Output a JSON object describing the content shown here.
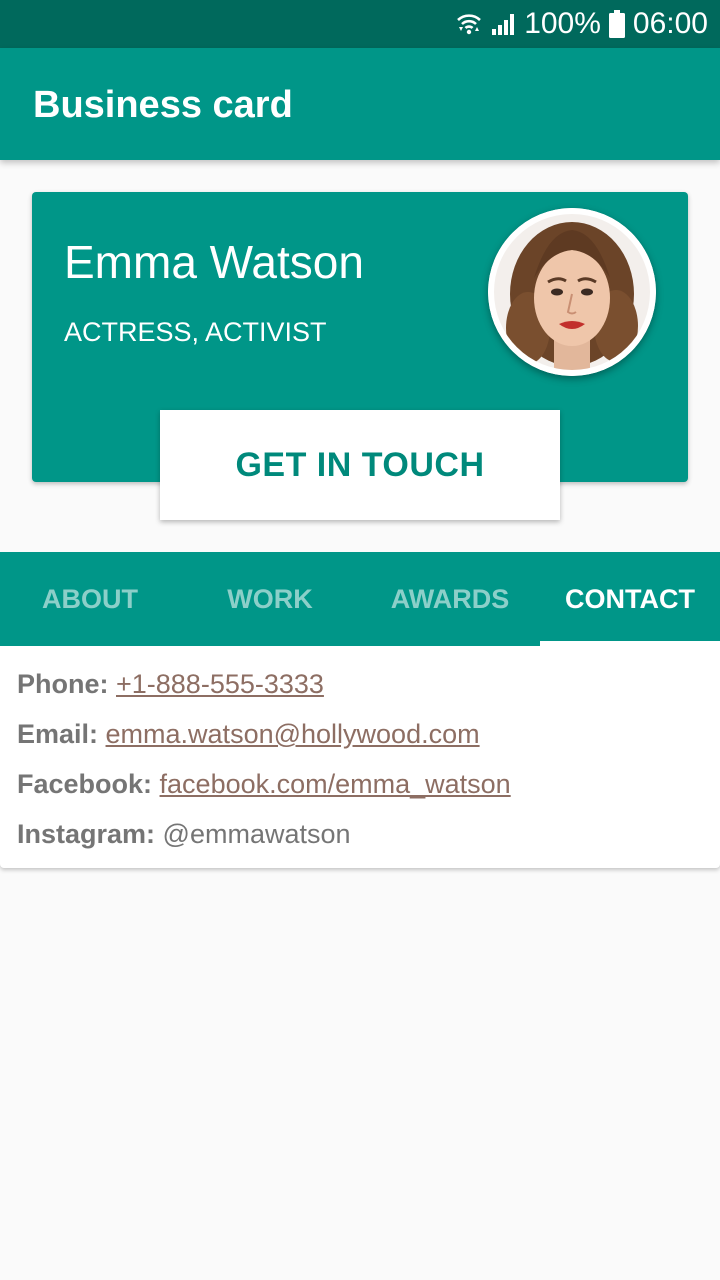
{
  "status_bar": {
    "battery": "100%",
    "time": "06:00"
  },
  "app_bar": {
    "title": "Business card"
  },
  "profile": {
    "name": "Emma Watson",
    "role": "ACTRESS, ACTIVIST",
    "button_label": "GET IN TOUCH"
  },
  "tabs": [
    {
      "label": "ABOUT",
      "active": false
    },
    {
      "label": "WORK",
      "active": false
    },
    {
      "label": "AWARDS",
      "active": false
    },
    {
      "label": "CONTACT",
      "active": true
    }
  ],
  "contact": {
    "phone_label": "Phone:",
    "phone": "+1-888-555-3333",
    "email_label": "Email:",
    "email": "emma.watson@hollywood.com",
    "facebook_label": "Facebook:",
    "facebook": "facebook.com/emma_watson",
    "instagram_label": "Instagram:",
    "instagram": "@emmawatson"
  },
  "colors": {
    "status_bar": "#00695c",
    "primary": "#009688",
    "button_text": "#00897b",
    "link": "#8d6e63",
    "label": "#757575",
    "background": "#fafafa"
  },
  "icons": [
    "wifi-icon",
    "signal-icon",
    "battery-icon"
  ]
}
